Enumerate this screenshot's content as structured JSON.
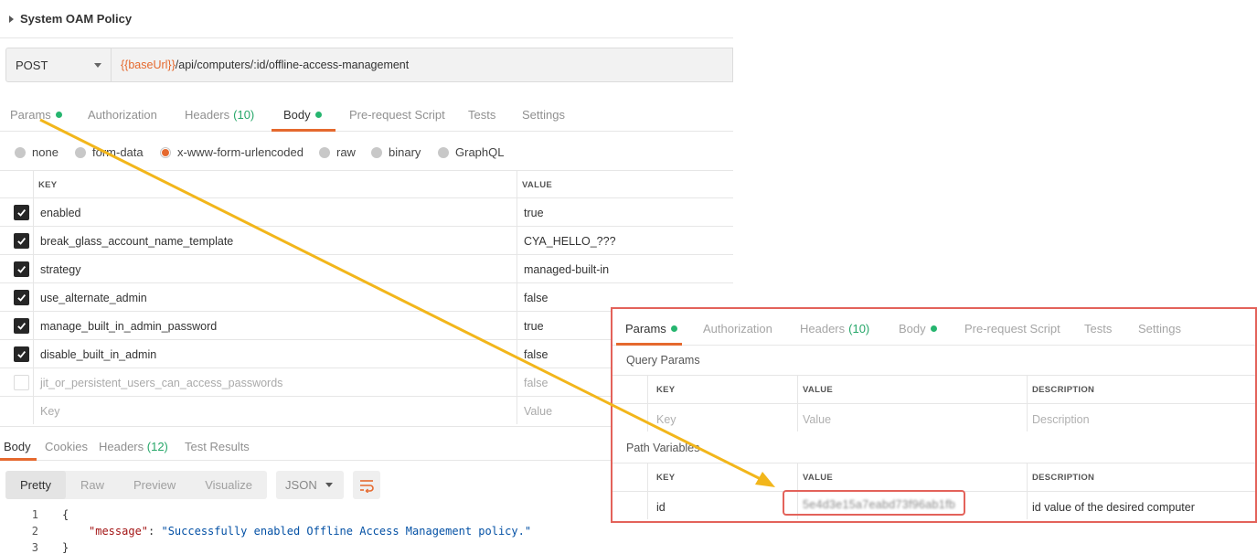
{
  "request": {
    "title": "System OAM Policy",
    "method": "POST",
    "url_var": "{{baseUrl}}",
    "url_path": "/api/computers/:id/offline-access-management"
  },
  "tabs": [
    {
      "label": "Params"
    },
    {
      "label": "Authorization"
    },
    {
      "label": "Headers",
      "count": "(10)"
    },
    {
      "label": "Body"
    },
    {
      "label": "Pre-request Script"
    },
    {
      "label": "Tests"
    },
    {
      "label": "Settings"
    }
  ],
  "body_options": [
    "none",
    "form-data",
    "x-www-form-urlencoded",
    "raw",
    "binary",
    "GraphQL"
  ],
  "kv_table": {
    "headers": {
      "key": "KEY",
      "value": "VALUE"
    },
    "rows": [
      {
        "key": "enabled",
        "value": "true",
        "checked": true
      },
      {
        "key": "break_glass_account_name_template",
        "value": "CYA_HELLO_???",
        "checked": true
      },
      {
        "key": "strategy",
        "value": "managed-built-in",
        "checked": true
      },
      {
        "key": "use_alternate_admin",
        "value": "false",
        "checked": true
      },
      {
        "key": "manage_built_in_admin_password",
        "value": "true",
        "checked": true
      },
      {
        "key": "disable_built_in_admin",
        "value": "false",
        "checked": true
      },
      {
        "key": "jit_or_persistent_users_can_access_passwords",
        "value": "false",
        "checked": false
      }
    ],
    "placeholder_key": "Key",
    "placeholder_value": "Value"
  },
  "response": {
    "tabs": [
      {
        "label": "Body"
      },
      {
        "label": "Cookies"
      },
      {
        "label": "Headers",
        "count": "(12)"
      },
      {
        "label": "Test Results"
      }
    ],
    "views": [
      "Pretty",
      "Raw",
      "Preview",
      "Visualize"
    ],
    "format": "JSON",
    "code": {
      "line1": "{",
      "key": "\"message\"",
      "colon": ": ",
      "value": "\"Successfully enabled Offline Access Management policy.\"",
      "line3": "}",
      "ln1": "1",
      "ln2": "2",
      "ln3": "3"
    }
  },
  "inset": {
    "query_params_title": "Query Params",
    "path_variables_title": "Path Variables",
    "headers": {
      "key": "KEY",
      "value": "VALUE",
      "description": "DESCRIPTION"
    },
    "query_placeholder": {
      "key": "Key",
      "value": "Value",
      "description": "Description"
    },
    "path_row": {
      "key": "id",
      "value": "5e4d3e15a7eabd73f96ab1fb",
      "description": "id value of the desired computer"
    }
  },
  "colors": {
    "accent": "#e5692e",
    "active_dot": "#26b56f",
    "highlight": "#e3625a",
    "arrow": "#f2b61b"
  }
}
